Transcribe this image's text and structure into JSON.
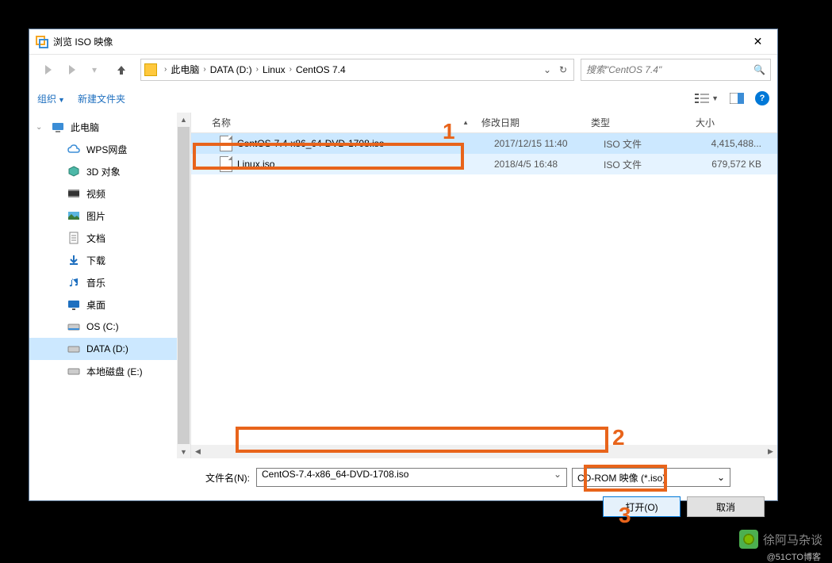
{
  "title": "浏览 ISO 映像",
  "breadcrumb": {
    "items": [
      "此电脑",
      "DATA (D:)",
      "Linux",
      "CentOS 7.4"
    ]
  },
  "search": {
    "placeholder": "搜索\"CentOS 7.4\""
  },
  "toolbar": {
    "organize": "组织",
    "newfolder": "新建文件夹"
  },
  "sidebar": {
    "items": [
      {
        "label": "此电脑",
        "icon": "pc"
      },
      {
        "label": "WPS网盘",
        "icon": "cloud"
      },
      {
        "label": "3D 对象",
        "icon": "cube"
      },
      {
        "label": "视频",
        "icon": "video"
      },
      {
        "label": "图片",
        "icon": "pic"
      },
      {
        "label": "文档",
        "icon": "doc"
      },
      {
        "label": "下载",
        "icon": "download"
      },
      {
        "label": "音乐",
        "icon": "music"
      },
      {
        "label": "桌面",
        "icon": "desktop"
      },
      {
        "label": "OS (C:)",
        "icon": "drive"
      },
      {
        "label": "DATA (D:)",
        "icon": "drive",
        "selected": true
      },
      {
        "label": "本地磁盘 (E:)",
        "icon": "drive"
      }
    ]
  },
  "columns": {
    "name": "名称",
    "date": "修改日期",
    "type": "类型",
    "size": "大小"
  },
  "files": [
    {
      "name": "CentOS-7.4-x86_64-DVD-1708.iso",
      "date": "2017/12/15 11:40",
      "type": "ISO 文件",
      "size": "4,415,488...",
      "selected": true
    },
    {
      "name": "Linux.iso",
      "date": "2018/4/5 16:48",
      "type": "ISO 文件",
      "size": "679,572 KB",
      "hover": true
    }
  ],
  "filename": {
    "label": "文件名(N):",
    "value": "CentOS-7.4-x86_64-DVD-1708.iso"
  },
  "filter": "CD-ROM 映像 (*.iso)",
  "buttons": {
    "open": "打开(O)",
    "cancel": "取消"
  },
  "annotations": {
    "n1": "1",
    "n2": "2",
    "n3": "3"
  },
  "watermark": {
    "text": "徐阿马杂谈",
    "sub": "@51CTO博客"
  }
}
